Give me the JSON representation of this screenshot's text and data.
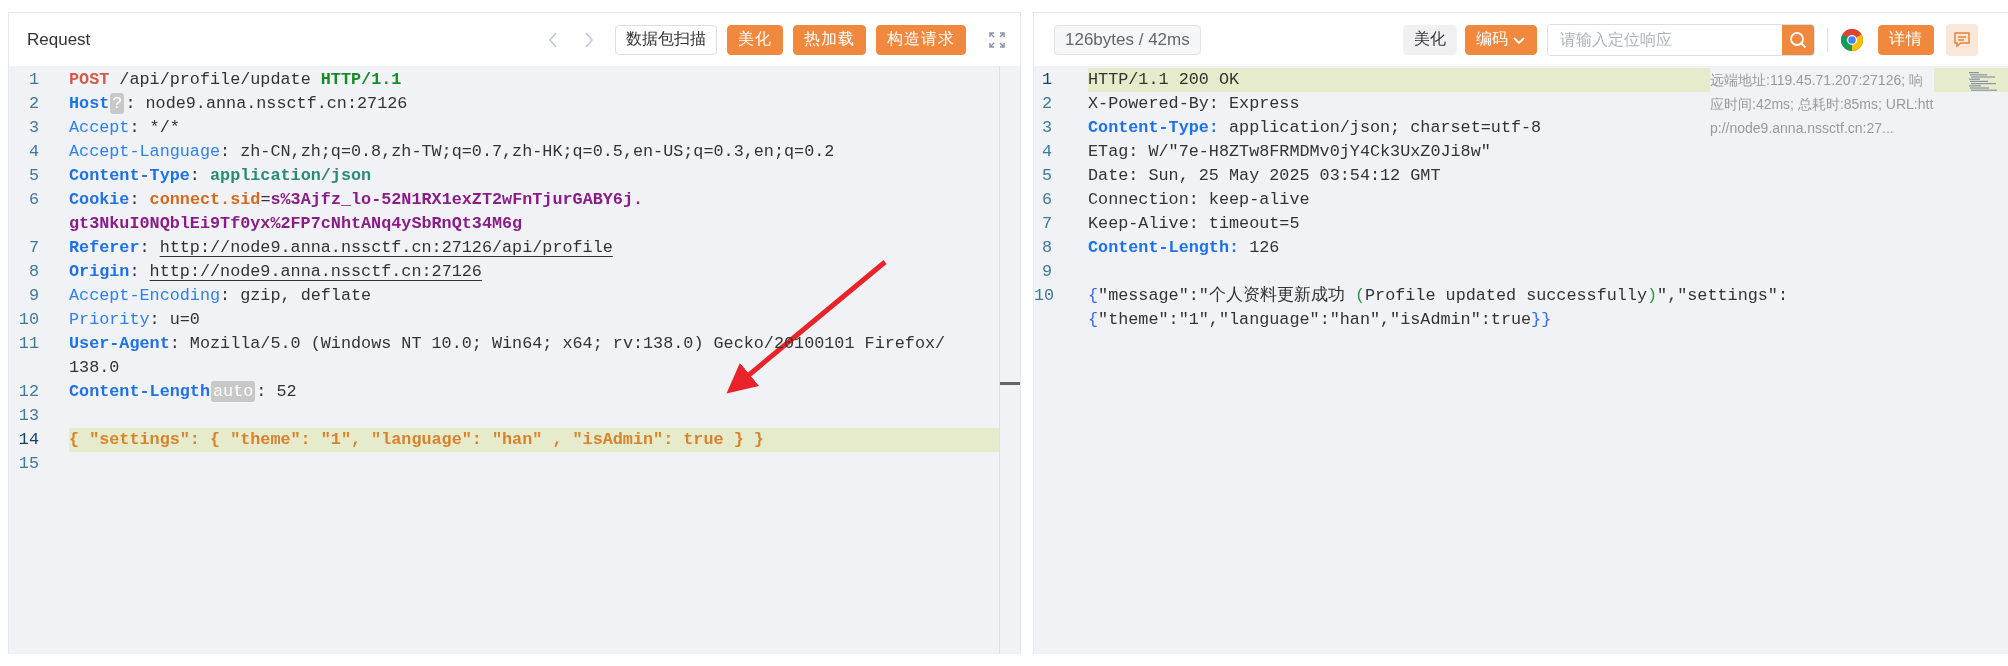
{
  "request": {
    "title": "Request",
    "nav": {
      "prev_disabled": true,
      "next_disabled": true
    },
    "buttons": [
      {
        "label": "数据包扫描",
        "kind": "outline"
      },
      {
        "label": "美化",
        "kind": "primary"
      },
      {
        "label": "热加载",
        "kind": "primary"
      },
      {
        "label": "构造请求",
        "kind": "primary"
      }
    ],
    "lines": [
      {
        "number": "1",
        "highlighted": false,
        "tokens": [
          {
            "kind": "method",
            "text": "POST"
          },
          {
            "kind": "plain",
            "text": " /api/profile/update "
          },
          {
            "kind": "version",
            "text": "HTTP/1.1"
          }
        ]
      },
      {
        "number": "2",
        "highlighted": false,
        "tokens": [
          {
            "kind": "key-strong",
            "text": "Host"
          },
          {
            "kind": "badge",
            "text": "?"
          },
          {
            "kind": "plain",
            "text": ": node9.anna.nssctf.cn:27126"
          }
        ]
      },
      {
        "number": "3",
        "highlighted": false,
        "tokens": [
          {
            "kind": "key",
            "text": "Accept"
          },
          {
            "kind": "plain",
            "text": ": */*"
          }
        ]
      },
      {
        "number": "4",
        "highlighted": false,
        "tokens": [
          {
            "kind": "key",
            "text": "Accept-Language"
          },
          {
            "kind": "plain",
            "text": ": zh-CN,zh;q=0.8,zh-TW;q=0.7,zh-HK;q=0.5,en-US;q=0.3,en;q=0.2"
          }
        ]
      },
      {
        "number": "5",
        "highlighted": false,
        "tokens": [
          {
            "kind": "key-strong",
            "text": "Content-Type"
          },
          {
            "kind": "plain",
            "text": ": "
          },
          {
            "kind": "type",
            "text": "application/json"
          }
        ]
      },
      {
        "number": "6",
        "highlighted": false,
        "tokens": [
          {
            "kind": "key-strong",
            "text": "Cookie"
          },
          {
            "kind": "plain",
            "text": ": "
          },
          {
            "kind": "cookie-name",
            "text": "connect.sid"
          },
          {
            "kind": "plain",
            "text": "="
          },
          {
            "kind": "cookie-value",
            "text": "s%3Ajfz_lo-52N1RX1exZT2wFnTjurGABY6j."
          },
          {
            "kind": "cookie-value-next",
            "text": "gt3NkuI0NQblEi9Tf0yx%2FP7cNhtANq4ySbRnQt34M6g"
          }
        ]
      },
      {
        "number": "7",
        "highlighted": false,
        "tokens": [
          {
            "kind": "key-strong",
            "text": "Referer"
          },
          {
            "kind": "plain",
            "text": ": "
          },
          {
            "kind": "link",
            "text": "http://node9.anna.nssctf.cn:27126/api/profile"
          }
        ]
      },
      {
        "number": "8",
        "highlighted": false,
        "tokens": [
          {
            "kind": "key-strong",
            "text": "Origin"
          },
          {
            "kind": "plain",
            "text": ": "
          },
          {
            "kind": "link",
            "text": "http://node9.anna.nssctf.cn:27126"
          }
        ]
      },
      {
        "number": "9",
        "highlighted": false,
        "tokens": [
          {
            "kind": "key",
            "text": "Accept-Encoding"
          },
          {
            "kind": "plain",
            "text": ": gzip, deflate"
          }
        ]
      },
      {
        "number": "10",
        "highlighted": false,
        "tokens": [
          {
            "kind": "key",
            "text": "Priority"
          },
          {
            "kind": "plain",
            "text": ": u=0"
          }
        ]
      },
      {
        "number": "11",
        "highlighted": false,
        "tokens": [
          {
            "kind": "key-strong",
            "text": "User-Agent"
          },
          {
            "kind": "plain",
            "text": ": Mozilla/5.0 (Windows NT 10.0; Win64; x64; rv:138.0) Gecko/20100101 Firefox/"
          },
          {
            "kind": "plain-next",
            "text": "138.0"
          }
        ]
      },
      {
        "number": "12",
        "highlighted": false,
        "tokens": [
          {
            "kind": "key-strong",
            "text": "Content-Length"
          },
          {
            "kind": "badge",
            "text": "auto"
          },
          {
            "kind": "plain",
            "text": ": 52"
          }
        ]
      },
      {
        "number": "13",
        "highlighted": false
      },
      {
        "number": "14",
        "highlighted": true,
        "tokens": [
          {
            "kind": "json",
            "text": "{ \"settings\": { \"theme\": \"1\", \"language\": \"han\" , \"isAdmin\": true } }"
          }
        ]
      },
      {
        "number": "15",
        "highlighted": false
      }
    ]
  },
  "response": {
    "stats": "126bytes / 42ms",
    "buttons": [
      {
        "label": "美化",
        "kind": "plain"
      },
      {
        "label": "编码",
        "kind": "dropdown"
      }
    ],
    "search": {
      "placeholder": "请输入定位响应"
    },
    "detail_button": {
      "label": "详情",
      "kind": "primary"
    },
    "info": "远端地址:119.45.71.207:27126; 响应时间:42ms; 总耗时:85ms; URL:http://node9.anna.nssctf.cn:27...",
    "lines": [
      {
        "number": "1",
        "highlighted": true,
        "tokens": [
          {
            "kind": "plain",
            "text": "HTTP/1.1 200 OK"
          }
        ]
      },
      {
        "number": "2",
        "highlighted": false,
        "tokens": [
          {
            "kind": "plain",
            "text": "X-Powered-By: Express"
          }
        ]
      },
      {
        "number": "3",
        "highlighted": false,
        "tokens": [
          {
            "kind": "key-strong",
            "text": "Content-Type:"
          },
          {
            "kind": "plain",
            "text": " application/json; charset=utf-8"
          }
        ]
      },
      {
        "number": "4",
        "highlighted": false,
        "tokens": [
          {
            "kind": "plain",
            "text": "ETag: W/\"7e-H8ZTw8FRMDMv0jY4Ck3UxZ0Ji8w\""
          }
        ]
      },
      {
        "number": "5",
        "highlighted": false,
        "tokens": [
          {
            "kind": "plain",
            "text": "Date: Sun, 25 May 2025 03:54:12 GMT"
          }
        ]
      },
      {
        "number": "6",
        "highlighted": false,
        "tokens": [
          {
            "kind": "plain",
            "text": "Connection: keep-alive"
          }
        ]
      },
      {
        "number": "7",
        "highlighted": false,
        "tokens": [
          {
            "kind": "plain",
            "text": "Keep-Alive: timeout=5"
          }
        ]
      },
      {
        "number": "8",
        "highlighted": false,
        "tokens": [
          {
            "kind": "key-strong",
            "text": "Content-Length:"
          },
          {
            "kind": "plain",
            "text": " 126"
          }
        ]
      },
      {
        "number": "9",
        "highlighted": false
      },
      {
        "number": "10",
        "highlighted": false,
        "tokens": [
          {
            "kind": "brace",
            "text": "{"
          },
          {
            "kind": "plain",
            "text": "\"message\":\"个人资料更新成功 "
          },
          {
            "kind": "paren",
            "text": "("
          },
          {
            "kind": "plain",
            "text": "Profile updated successfully"
          },
          {
            "kind": "paren",
            "text": ")"
          },
          {
            "kind": "plain",
            "text": "\",\"settings\":"
          },
          {
            "kind": "brace-next",
            "text": "{"
          },
          {
            "kind": "plain",
            "text": "\"theme\":\"1\",\"language\":\"han\",\"isAdmin\":true"
          },
          {
            "kind": "brace",
            "text": "}}"
          }
        ]
      }
    ]
  }
}
